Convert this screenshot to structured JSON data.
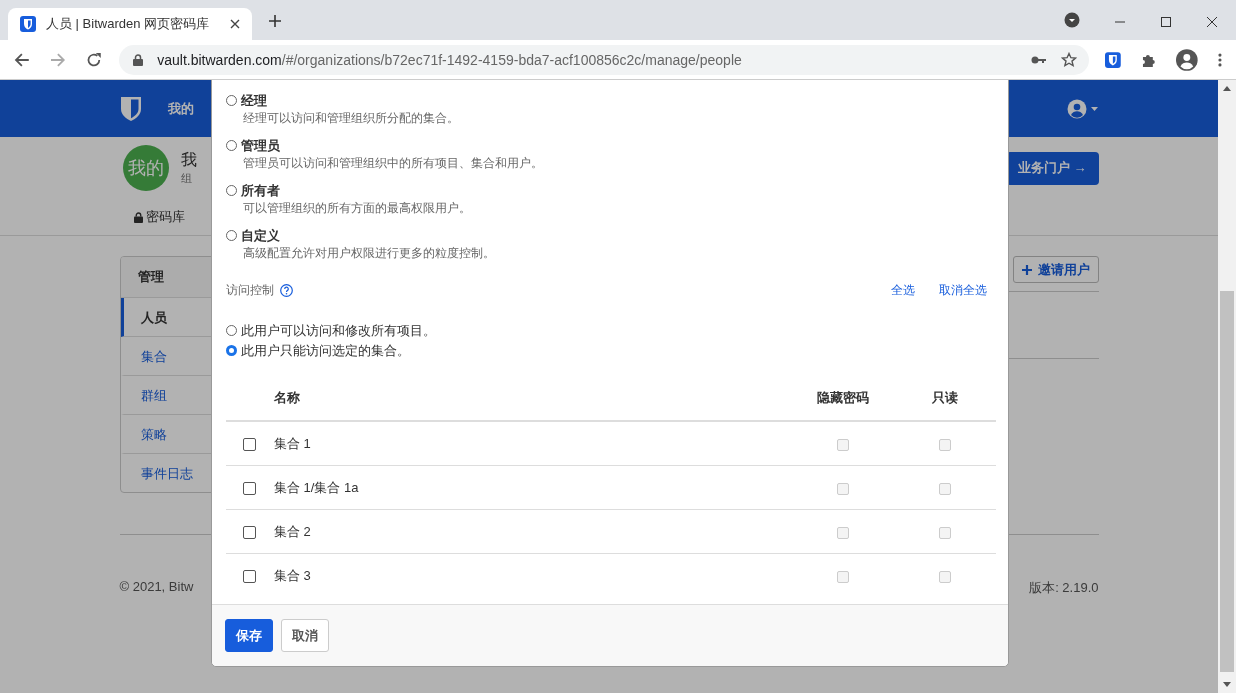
{
  "browser": {
    "tab_title": "人员 | Bitwarden 网页密码库",
    "url_host": "vault.bitwarden.com",
    "url_path": "/#/organizations/b72ec71f-1492-4159-bda7-acf100856c2c/manage/people"
  },
  "navbar": {
    "link": "我的"
  },
  "org": {
    "avatar": "我的",
    "name": "我",
    "subtitle": "组",
    "tab": "密码库",
    "portal_button": "业务门户 →"
  },
  "sidebar": {
    "heading": "管理",
    "items": [
      {
        "label": "人员",
        "selected": true
      },
      {
        "label": "集合",
        "selected": false
      },
      {
        "label": "群组",
        "selected": false
      },
      {
        "label": "策略",
        "selected": false
      },
      {
        "label": "事件日志",
        "selected": false
      }
    ]
  },
  "invite_button": "邀请用户",
  "footer": {
    "copyright": "© 2021, Bitw",
    "version": "版本: 2.19.0"
  },
  "modal": {
    "roles": [
      {
        "title": "经理",
        "description": "经理可以访问和管理组织所分配的集合。",
        "selected": false
      },
      {
        "title": "管理员",
        "description": "管理员可以访问和管理组织中的所有项目、集合和用户。",
        "selected": false
      },
      {
        "title": "所有者",
        "description": "可以管理组织的所有方面的最高权限用户。",
        "selected": false
      },
      {
        "title": "自定义",
        "description": "高级配置允许对用户权限进行更多的粒度控制。",
        "selected": false
      }
    ],
    "access_control": {
      "label": "访问控制",
      "select_all": "全选",
      "deselect_all": "取消全选",
      "options": [
        {
          "label": "此用户可以访问和修改所有项目。",
          "selected": false
        },
        {
          "label": "此用户只能访问选定的集合。",
          "selected": true
        }
      ]
    },
    "table": {
      "columns": [
        "名称",
        "隐藏密码",
        "只读"
      ],
      "rows": [
        {
          "name": "集合 1",
          "checked": false,
          "hide_passwords": false,
          "read_only": false,
          "disabled": true
        },
        {
          "name": "集合 1/集合 1a",
          "checked": false,
          "hide_passwords": false,
          "read_only": false,
          "disabled": true
        },
        {
          "name": "集合 2",
          "checked": false,
          "hide_passwords": false,
          "read_only": false,
          "disabled": true
        },
        {
          "name": "集合 3",
          "checked": false,
          "hide_passwords": false,
          "read_only": false,
          "disabled": true
        }
      ]
    },
    "save_button": "保存",
    "cancel_button": "取消"
  }
}
